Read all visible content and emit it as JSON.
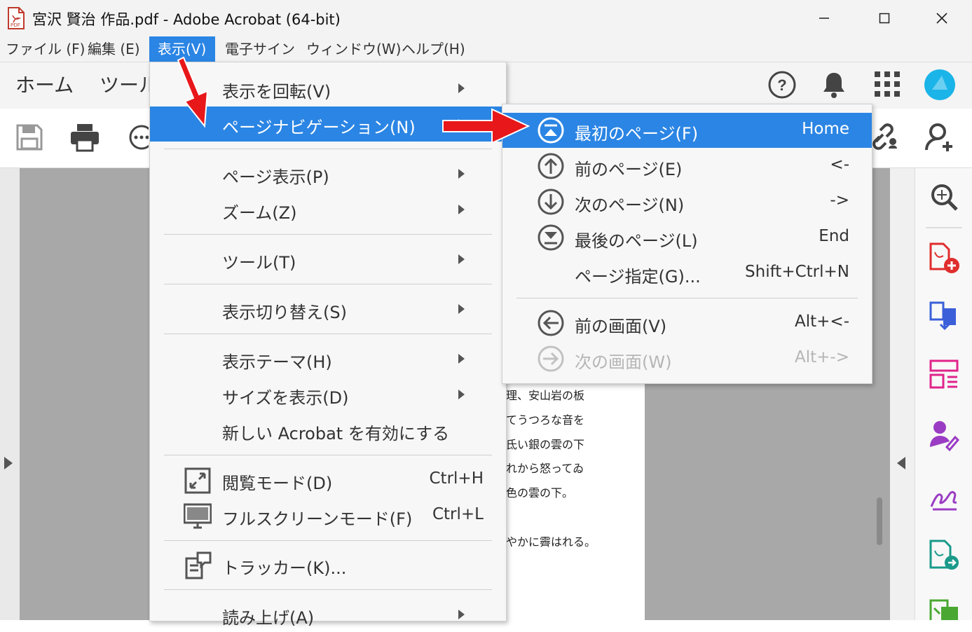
{
  "window": {
    "title": "宮沢 賢治 作品.pdf - Adobe Acrobat (64-bit)",
    "icon": "pdf-file-icon",
    "controls": [
      "minimize-icon",
      "maximize-icon",
      "close-icon"
    ]
  },
  "menubar": {
    "items": [
      {
        "label": "ファイル (F)"
      },
      {
        "label": "編集 (E)"
      },
      {
        "label": "表示(V)",
        "active": true
      },
      {
        "label": "電子サイン"
      },
      {
        "label": "ウィンドウ(W)"
      },
      {
        "label": "ヘルプ(H)"
      }
    ]
  },
  "tabs": {
    "home": "ホーム",
    "tools": "ツール"
  },
  "header_icons": [
    "help-icon",
    "bell-icon",
    "apps-grid-icon",
    "profile-icon"
  ],
  "toolbar_icons": [
    "save-icon",
    "print-icon",
    "more-icon",
    "link-icon",
    "add-user-icon"
  ],
  "document": {
    "lines": [
      "理、安山岩の板",
      "てうつろな音を",
      "氐い銀の雲の下",
      "れから怒ってゐ",
      "色の雲の下。",
      "やかに霽はれる。"
    ]
  },
  "view_menu": {
    "items": [
      {
        "label": "表示を回転(V)",
        "submenu": true
      },
      {
        "label": "ページナビゲーション(N)",
        "submenu": true,
        "highlighted": true
      },
      {
        "label": "ページ表示(P)",
        "submenu": true
      },
      {
        "label": "ズーム(Z)",
        "submenu": true
      },
      {
        "label": "ツール(T)",
        "submenu": true
      },
      {
        "label": "表示切り替え(S)",
        "submenu": true
      },
      {
        "label": "表示テーマ(H)",
        "submenu": true
      },
      {
        "label": "サイズを表示(D)",
        "submenu": true
      },
      {
        "label": "新しい Acrobat を有効にする"
      },
      {
        "label": "閲覧モード(D)",
        "shortcut": "Ctrl+H",
        "icon": "reading-mode-icon"
      },
      {
        "label": "フルスクリーンモード(F)",
        "shortcut": "Ctrl+L",
        "icon": "fullscreen-icon"
      },
      {
        "label": "トラッカー(K)...",
        "icon": "tracker-icon"
      },
      {
        "label": "読み上げ(A)",
        "submenu": true
      }
    ]
  },
  "page_nav_submenu": {
    "items": [
      {
        "label": "最初のページ(F)",
        "shortcut": "Home",
        "icon": "first-page-icon",
        "highlighted": true
      },
      {
        "label": "前のページ(E)",
        "shortcut": "<-",
        "icon": "previous-page-icon"
      },
      {
        "label": "次のページ(N)",
        "shortcut": "->",
        "icon": "next-page-icon"
      },
      {
        "label": "最後のページ(L)",
        "shortcut": "End",
        "icon": "last-page-icon"
      },
      {
        "label": "ページ指定(G)...",
        "shortcut": "Shift+Ctrl+N"
      },
      {
        "label": "前の画面(V)",
        "shortcut": "Alt+<-",
        "icon": "previous-view-icon"
      },
      {
        "label": "次の画面(W)",
        "shortcut": "Alt+->",
        "icon": "next-view-icon",
        "disabled": true
      }
    ]
  },
  "right_panel_icons": [
    "zoom-search-icon",
    "create-pdf-icon",
    "combine-files-icon",
    "organize-pages-icon",
    "request-signature-icon",
    "fill-sign-icon",
    "export-pdf-icon",
    "compress-icon"
  ],
  "colors": {
    "accent": "#2b85e4",
    "arrow": "#e8171a"
  }
}
